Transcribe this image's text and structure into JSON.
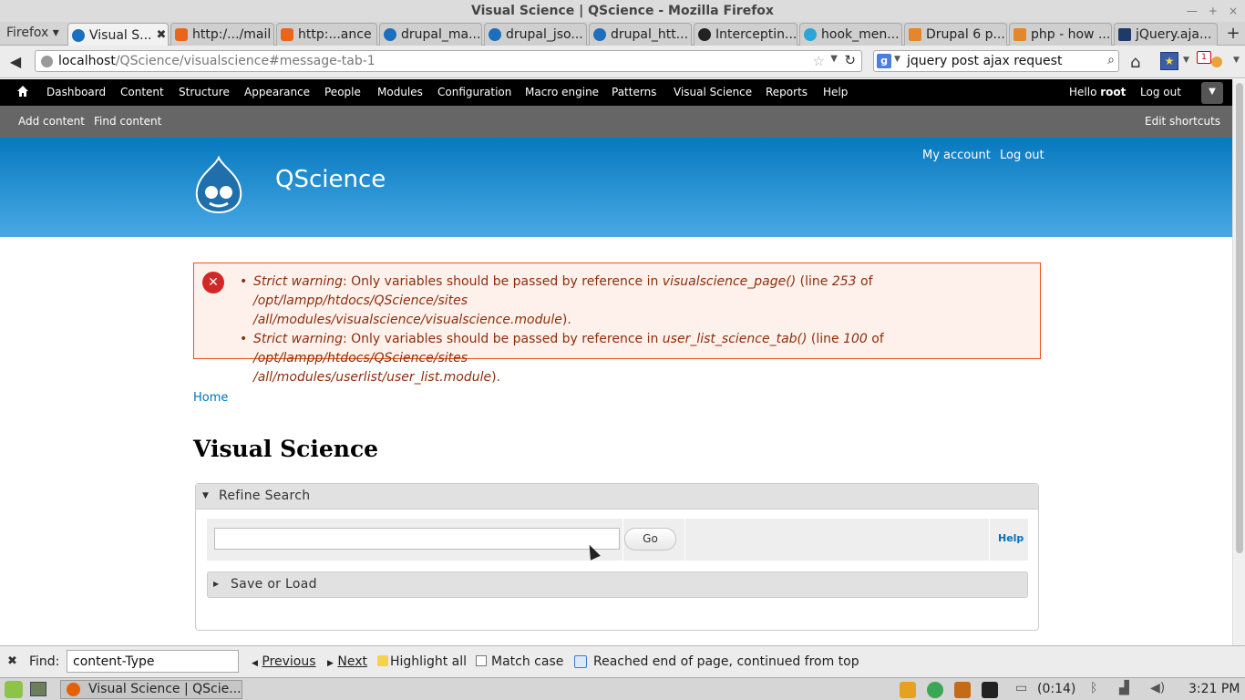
{
  "window": {
    "title": "Visual Science | QScience - Mozilla Firefox"
  },
  "browser": {
    "menu_label": "Firefox ▾",
    "tabs": [
      {
        "label": "Visual S...",
        "icon": "drupal-icon",
        "active": true
      },
      {
        "label": "http:/.../mail",
        "icon": "xampp-icon"
      },
      {
        "label": "http:...ance",
        "icon": "xampp-icon"
      },
      {
        "label": "drupal_ma...",
        "icon": "drupal-icon"
      },
      {
        "label": "drupal_jso...",
        "icon": "drupal-icon"
      },
      {
        "label": "drupal_htt...",
        "icon": "drupal-icon"
      },
      {
        "label": "Interceptin...",
        "icon": "github-icon"
      },
      {
        "label": "hook_men...",
        "icon": "drupal-api-icon"
      },
      {
        "label": "Drupal 6 p...",
        "icon": "stackoverflow-icon"
      },
      {
        "label": "php - how ...",
        "icon": "stackoverflow-icon"
      },
      {
        "label": "jQuery.aja...",
        "icon": "jquery-icon"
      }
    ],
    "url_host": "localhost",
    "url_path": "/QScience/visualscience#message-tab-1",
    "search_value": "jquery post ajax request",
    "notification_count": "1"
  },
  "toolbar": {
    "items": [
      "Dashboard",
      "Content",
      "Structure",
      "Appearance",
      "People",
      "Modules",
      "Configuration",
      "Macro engine",
      "Patterns",
      "Visual Science",
      "Reports",
      "Help"
    ],
    "hello_prefix": "Hello ",
    "user": "root",
    "logout": "Log out",
    "shortcuts": [
      "Add content",
      "Find content"
    ],
    "edit_shortcuts": "Edit shortcuts"
  },
  "header": {
    "site_name": "QScience",
    "secondary_menu": [
      "My account",
      "Log out"
    ]
  },
  "messages": [
    {
      "label": "Strict warning",
      "text": ": Only variables should be passed by reference in ",
      "func": "visualscience_page()",
      "line_prefix": " (line ",
      "line": "253",
      "of": " of ",
      "file_a": "/opt/lampp/htdocs/QScience/sites",
      "file_b": "/all/modules/visualscience/visualscience.module",
      "end": ")."
    },
    {
      "label": "Strict warning",
      "text": ": Only variables should be passed by reference in ",
      "func": "user_list_science_tab()",
      "line_prefix": " (line ",
      "line": "100",
      "of": " of ",
      "file_a": "/opt/lampp/htdocs/QScience/sites",
      "file_b": "/all/modules/userlist/user_list.module",
      "end": ")."
    }
  ],
  "breadcrumb": "Home",
  "page_title": "Visual Science",
  "refine": {
    "legend": "Refine Search",
    "input_value": "",
    "go_label": "Go",
    "help_label": "Help",
    "save_load_legend": "Save or Load"
  },
  "findbar": {
    "label": "Find:",
    "value": "content-Type",
    "previous": "Previous",
    "next": "Next",
    "highlight": "Highlight all",
    "match_case": "Match case",
    "status": "Reached end of page, continued from top"
  },
  "taskbar": {
    "window_button": "Visual Science | QScie...",
    "battery": "(0:14)",
    "clock": "3:21 PM"
  }
}
